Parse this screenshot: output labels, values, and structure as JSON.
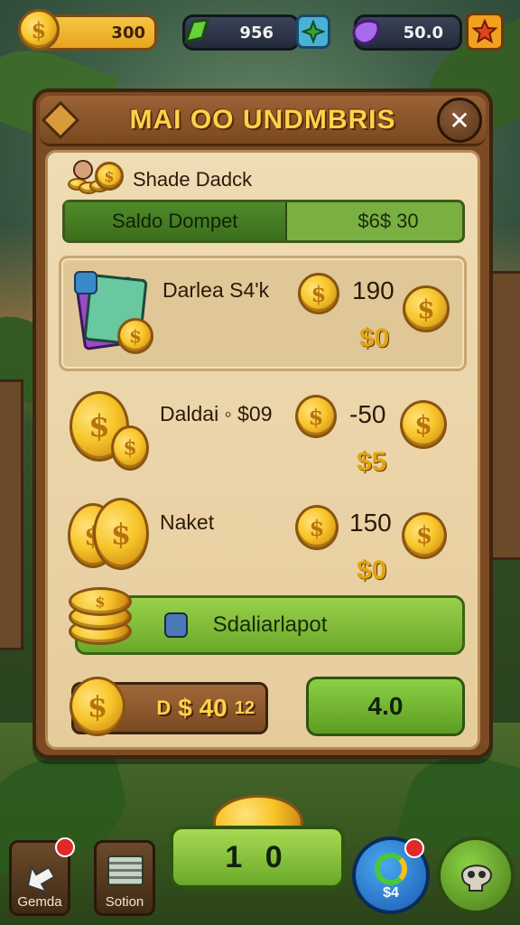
{
  "topbar": {
    "coins_value": "300",
    "gems_value": "956",
    "crystals_value": "50.0",
    "coin_icon": "dollar-coin-icon",
    "gem_icon": "green-gem-icon",
    "crystal_icon": "purple-crystal-icon",
    "gem_plus_icon": "plus-icon",
    "star_icon": "star-icon"
  },
  "panel": {
    "title": "MAI OO UNDMBRIS",
    "subtitle": "Shade Dadck",
    "balance_label": "Saldo Dompet",
    "balance_value": "$6$ 30",
    "close_label": "✕"
  },
  "offers": [
    {
      "name": "Darlea S4'k",
      "amount": "190",
      "price": "$0"
    },
    {
      "name": "Daldai ◦ $09",
      "amount": "-50",
      "price": "$5"
    },
    {
      "name": "Naket",
      "amount": "150",
      "price": "$0"
    }
  ],
  "claim_button": {
    "label": "Sdaliarlapot"
  },
  "footer": {
    "left_prefix": "D",
    "left_value": "$ 40",
    "left_suffix": "12",
    "right_value": "4.0"
  },
  "nav": {
    "left_label": "Gemda",
    "second_label": "Sotion",
    "center_value": "1 0",
    "right_badge": "$4"
  },
  "colors": {
    "accent_gold": "#f7c52a",
    "panel_brown": "#7a4a22",
    "parchment": "#efdcb4",
    "button_green": "#7ab042",
    "notify_red": "#e02a2a"
  }
}
